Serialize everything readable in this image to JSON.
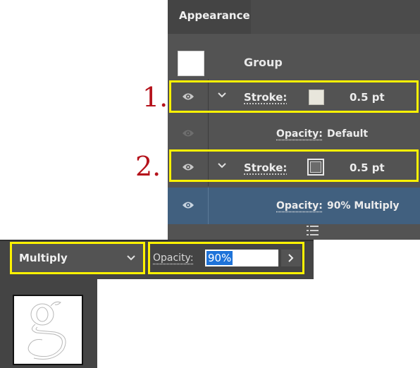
{
  "panel": {
    "title": "Appearance",
    "group_label": "Group",
    "rows": [
      {
        "stroke_label": "Stroke:",
        "weight": "0.5 pt",
        "swatch_color": "#e8e6dc"
      },
      {
        "opacity_label": "Opacity:",
        "opacity_value": "Default"
      },
      {
        "stroke_label": "Stroke:",
        "weight": "0.5 pt",
        "swatch_color": "#6b6b6b"
      },
      {
        "opacity_label": "Opacity:",
        "opacity_value": "90% Multiply"
      }
    ],
    "selected_row_color": "#41607f"
  },
  "annotations": {
    "num1": "1.",
    "num2": "2.",
    "highlight_color": "#fff200",
    "number_color": "#b5121b"
  },
  "toolbar": {
    "blend_mode": "Multiply",
    "opacity_label": "Opacity:",
    "opacity_value": "90%"
  },
  "icons": [
    "eye-icon",
    "chevron-down-icon",
    "chevron-right-icon",
    "panel-menu-icon"
  ]
}
